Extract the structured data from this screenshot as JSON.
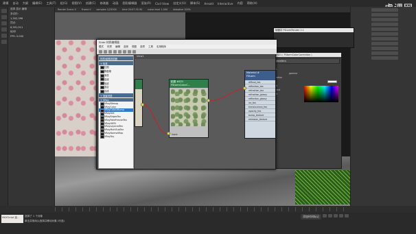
{
  "app": {
    "menu": [
      "建模",
      "自动",
      "大纲",
      "编辑(E)",
      "工具(T)",
      "组(G)",
      "视图(V)",
      "创建(C)",
      "修改器",
      "动画",
      "图形编辑器",
      "渲染(R)",
      "Civil View",
      "自定义(U)",
      "脚本(S)",
      "Arnold",
      "Interactive",
      "内容",
      "帮助(H)"
    ],
    "watermark": "虎课网"
  },
  "explorer": {
    "rows": [
      "选择 显示 编辑",
      "多边形:",
      "顶点:",
      "帧/秒"
    ],
    "stats": [
      "1,302,396",
      "6,391,911",
      "FPS: 0.000"
    ]
  },
  "viewport": {
    "header": [
      "Render Scene 0",
      "Frame 0",
      "samples 1/23000",
      "time 00:07:35.90",
      "noise level 1.000",
      "Adaptive 100%"
    ]
  },
  "slate": {
    "title": "Slate 材质编辑器",
    "menu": [
      "模式",
      "材质",
      "编辑",
      "选择",
      "视图",
      "选项",
      "工具",
      "实用程序"
    ],
    "view_tab": "View1",
    "browser": {
      "sections": [
        "材质/贴图浏览器",
        "+ 标准",
        "+ 场景材质",
        "+ VRay"
      ],
      "items": [
        "位图",
        "棋盘格",
        "渐变",
        "衰减",
        "噪波",
        "混合",
        "合成",
        "VRayBitmap",
        "VRayColor",
        "VRayColor2Bump",
        "VRayDirt",
        "VRayEdgesTex",
        "VRayFakeFresnelTex",
        "VRayHDRI",
        "VRayLayeredTex",
        "VRayMultiSubTex",
        "VRayNormalMap",
        "VRaySky"
      ],
      "selected": "VRayColor2Bump"
    },
    "nodes": {
      "map_title_1": "贴图 #421",
      "map_title_2": "FStormColorC...",
      "map_port": "input",
      "material_title_1": "Material #",
      "material_title_2": "FStorm",
      "material_ports": [
        "diffuse_tex",
        "reflection_tex",
        "refraction_tex",
        "refraction_glossy",
        "reflection_glossy",
        "ior_tex",
        "translucence_tex",
        "opacity_tex",
        "bump_texture",
        "emission_texture"
      ]
    }
  },
  "params": {
    "title": "贴图 #421 ( FStormColorCorrection )",
    "section": "Parameters",
    "labels": [
      "input",
      "gamma",
      "saturation",
      "hue",
      "offset",
      "contrast",
      "invert"
    ]
  },
  "vfb": {
    "title": "帧缓冲 FStormRender 2.1",
    "subtitle": "FStormRender 2.1"
  },
  "status": {
    "line1": "选择了 1 个对象",
    "line2": "单击并拖动以选择并移动对象 (可选)",
    "maxscript": "MAXScript 迷...",
    "add_time": "添加时间标记"
  }
}
